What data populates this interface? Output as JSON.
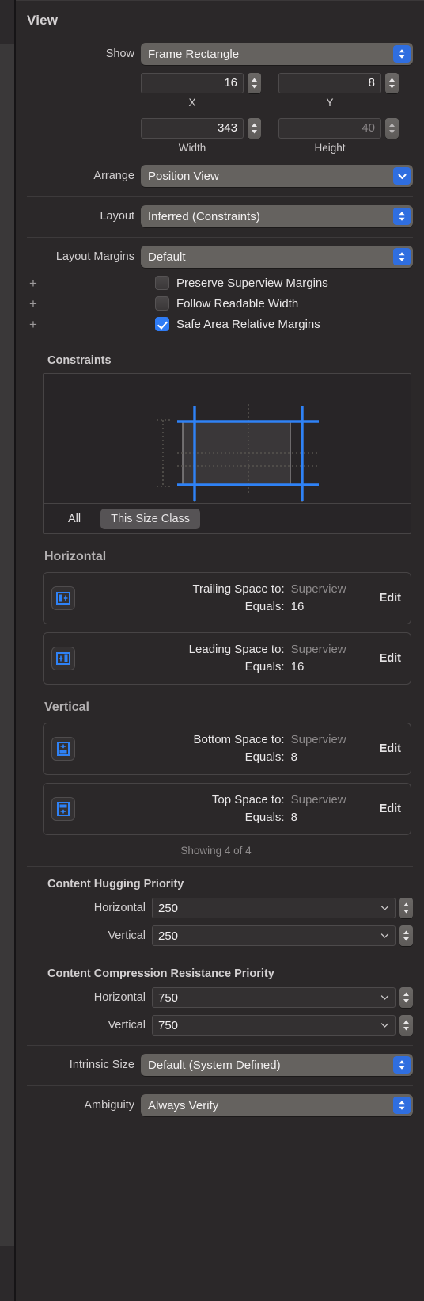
{
  "inspector": {
    "title": "View",
    "show": {
      "label": "Show",
      "value": "Frame Rectangle"
    },
    "frame": {
      "x": {
        "value": "16",
        "caption": "X"
      },
      "y": {
        "value": "8",
        "caption": "Y"
      },
      "width": {
        "value": "343",
        "caption": "Width"
      },
      "height": {
        "value": "40",
        "caption": "Height"
      }
    },
    "arrange": {
      "label": "Arrange",
      "value": "Position View"
    },
    "layout": {
      "label": "Layout",
      "value": "Inferred (Constraints)"
    },
    "layout_margins": {
      "label": "Layout Margins",
      "value": "Default"
    },
    "margin_checkboxes": [
      {
        "label": "Preserve Superview Margins",
        "checked": false,
        "add": "+"
      },
      {
        "label": "Follow Readable Width",
        "checked": false,
        "add": "+"
      },
      {
        "label": "Safe Area Relative Margins",
        "checked": true,
        "add": "+"
      }
    ],
    "constraints": {
      "title": "Constraints",
      "scope": {
        "all": "All",
        "size_class": "This Size Class",
        "selected": "This Size Class"
      },
      "horizontal_title": "Horizontal",
      "vertical_title": "Vertical",
      "edit_label": "Edit",
      "equals_label": "Equals:",
      "items_horizontal": [
        {
          "icon": "constraint-trailing-icon",
          "key": "Trailing Space to:",
          "target": "Superview",
          "equals_key": "Equals:",
          "equals_value": "16"
        },
        {
          "icon": "constraint-leading-icon",
          "key": "Leading Space to:",
          "target": "Superview",
          "equals_key": "Equals:",
          "equals_value": "16"
        }
      ],
      "items_vertical": [
        {
          "icon": "constraint-bottom-icon",
          "key": "Bottom Space to:",
          "target": "Superview",
          "equals_key": "Equals:",
          "equals_value": "8"
        },
        {
          "icon": "constraint-top-icon",
          "key": "Top Space to:",
          "target": "Superview",
          "equals_key": "Equals:",
          "equals_value": "8"
        }
      ],
      "showing": "Showing 4 of 4"
    },
    "content_hugging": {
      "title": "Content Hugging Priority",
      "horizontal": {
        "label": "Horizontal",
        "value": "250"
      },
      "vertical": {
        "label": "Vertical",
        "value": "250"
      }
    },
    "compression_resistance": {
      "title": "Content Compression Resistance Priority",
      "horizontal": {
        "label": "Horizontal",
        "value": "750"
      },
      "vertical": {
        "label": "Vertical",
        "value": "750"
      }
    },
    "intrinsic_size": {
      "label": "Intrinsic Size",
      "value": "Default (System Defined)"
    },
    "ambiguity": {
      "label": "Ambiguity",
      "value": "Always Verify"
    },
    "colors": {
      "accent_blue": "#2f6ee0",
      "checkbox_blue": "#2f7cf6",
      "constraint_line_blue": "#2f82f6",
      "panel_bg": "#2b2829",
      "field_bg": "#333031",
      "popup_bg": "#65625f"
    }
  }
}
